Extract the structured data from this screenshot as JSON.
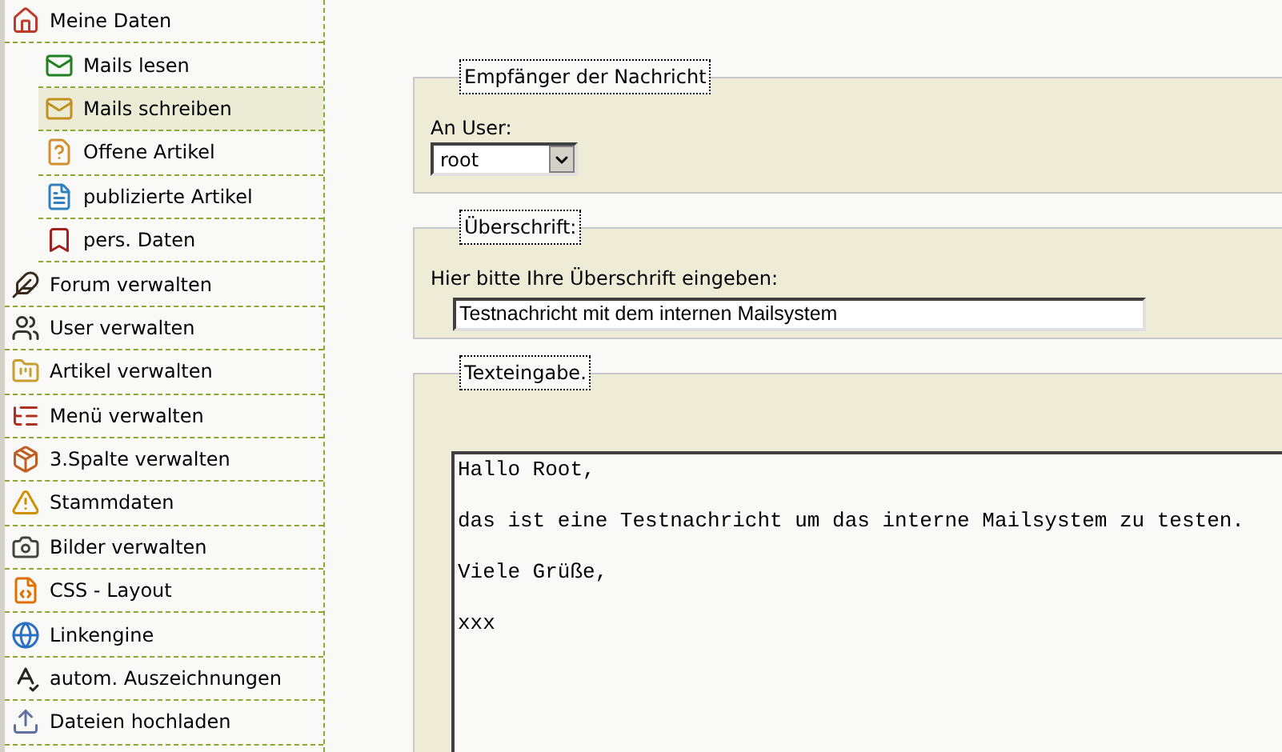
{
  "sidebar": {
    "items": [
      {
        "label": "Meine Daten",
        "selected": false,
        "children": [
          {
            "label": "Mails lesen",
            "selected": false
          },
          {
            "label": "Mails schreiben",
            "selected": true
          },
          {
            "label": "Offene Artikel",
            "selected": false
          },
          {
            "label": "publizierte Artikel",
            "selected": false
          },
          {
            "label": "pers. Daten",
            "selected": false
          }
        ]
      },
      {
        "label": "Forum verwalten",
        "selected": false
      },
      {
        "label": "User verwalten",
        "selected": false
      },
      {
        "label": "Artikel verwalten",
        "selected": false
      },
      {
        "label": "Menü verwalten",
        "selected": false
      },
      {
        "label": "3.Spalte verwalten",
        "selected": false
      },
      {
        "label": "Stammdaten",
        "selected": false
      },
      {
        "label": "Bilder verwalten",
        "selected": false
      },
      {
        "label": "CSS - Layout",
        "selected": false
      },
      {
        "label": "Linkengine",
        "selected": false
      },
      {
        "label": "autom. Auszeichnungen",
        "selected": false
      },
      {
        "label": "Dateien hochladen",
        "selected": false
      }
    ]
  },
  "recipient": {
    "legend": "Empfänger der Nachricht",
    "label": "An User:",
    "value": "root"
  },
  "subject": {
    "legend": "Überschrift:",
    "label": "Hier bitte Ihre Überschrift eingeben:",
    "value": "Testnachricht mit dem internen Mailsystem"
  },
  "body": {
    "legend": "Texteingabe.",
    "value": "Hallo Root,\n\ndas ist eine Testnachricht um das interne Mailsystem zu testen.\n\nViele Grüße,\n\nxxx"
  }
}
